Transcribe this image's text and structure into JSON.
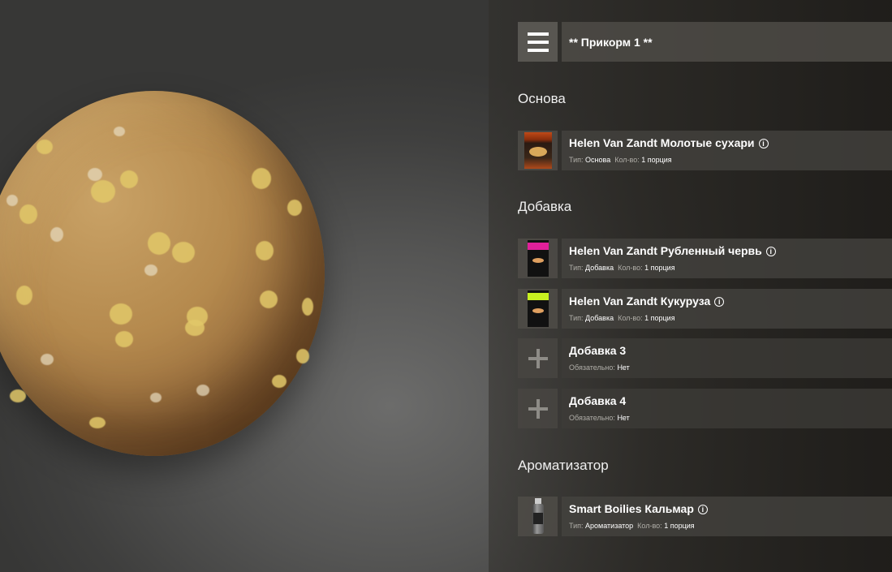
{
  "header": {
    "title": "** Прикорм 1 **"
  },
  "labels": {
    "type": "Тип:",
    "qty": "Кол-во:",
    "required": "Обязательно:"
  },
  "sections": {
    "base": {
      "title": "Основа",
      "items": [
        {
          "name": "Helen Van Zandt Молотые сухари",
          "type": "Основа",
          "qty": "1 порция",
          "icon": "breadcrumbs-package-icon"
        }
      ]
    },
    "additive": {
      "title": "Добавка",
      "items": [
        {
          "name": "Helen Van Zandt Рубленный червь",
          "type": "Добавка",
          "qty": "1 порция",
          "icon": "chopped-worm-package-icon",
          "band_color": "#e0209a"
        },
        {
          "name": "Helen Van Zandt Кукуруза",
          "type": "Добавка",
          "qty": "1 порция",
          "icon": "corn-package-icon",
          "band_color": "#c8f020"
        }
      ],
      "slots": [
        {
          "name": "Добавка 3",
          "required": "Нет"
        },
        {
          "name": "Добавка 4",
          "required": "Нет"
        }
      ]
    },
    "flavor": {
      "title": "Ароматизатор",
      "items": [
        {
          "name": "Smart Boilies Кальмар",
          "type": "Ароматизатор",
          "qty": "1 порция",
          "icon": "flavor-bottle-icon"
        }
      ]
    }
  },
  "info_glyph": "i",
  "add_glyph_icon": "plus-icon"
}
